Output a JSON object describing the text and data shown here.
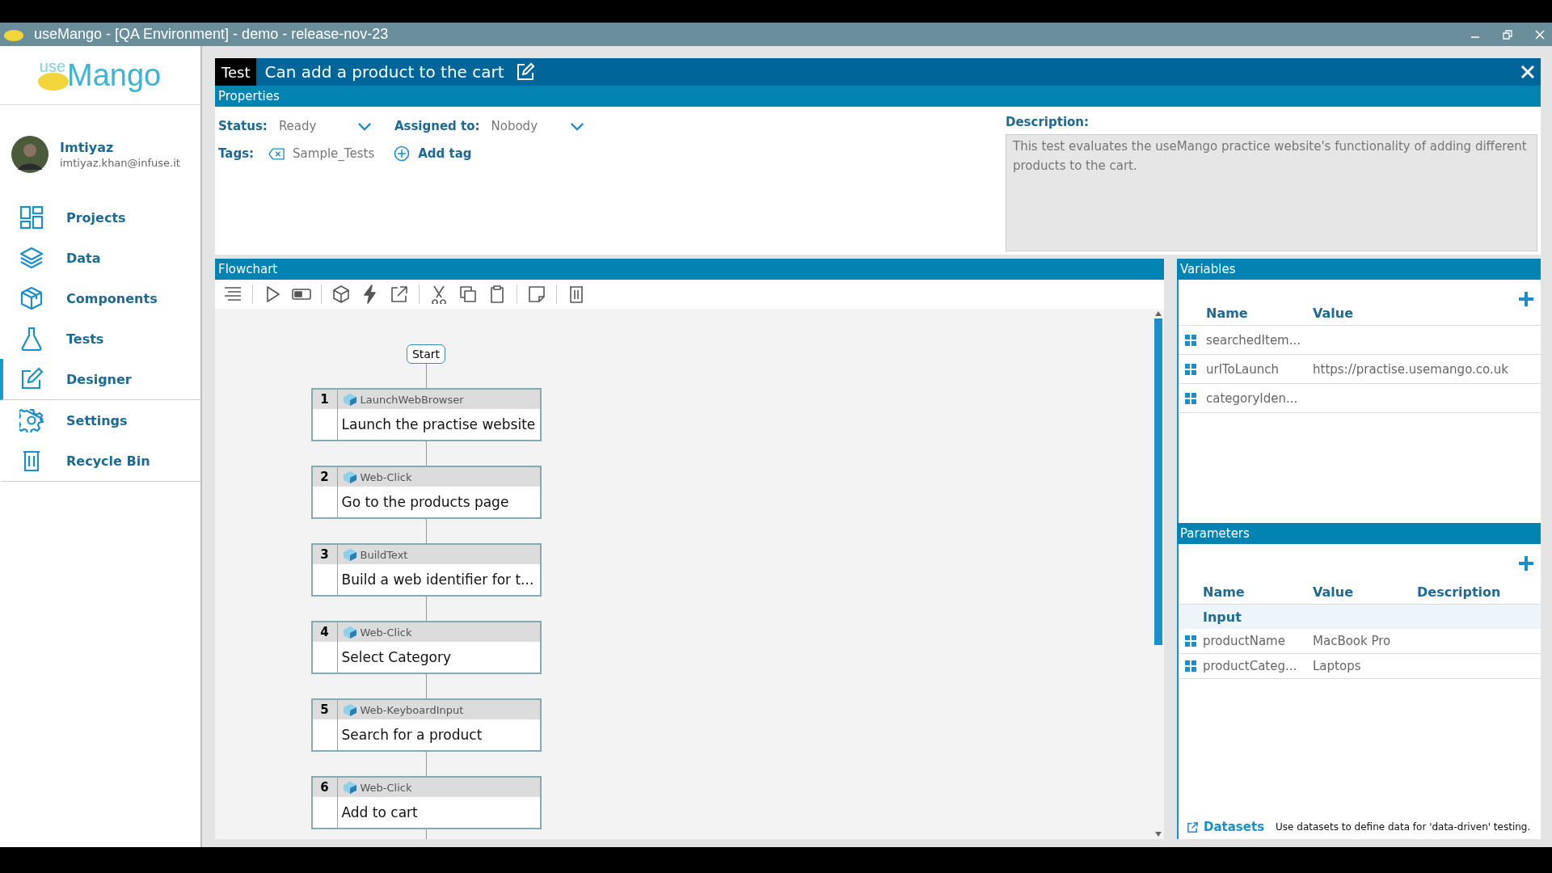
{
  "window": {
    "title": "useMango - [QA Environment] - demo - release-nov-23"
  },
  "logo": {
    "prefix": "use",
    "name": "Mango"
  },
  "user": {
    "name": "Imtiyaz",
    "email": "imtiyaz.khan@infuse.it"
  },
  "nav": [
    {
      "label": "Projects",
      "selected": false
    },
    {
      "label": "Data",
      "selected": false
    },
    {
      "label": "Components",
      "selected": false
    },
    {
      "label": "Tests",
      "selected": false
    },
    {
      "label": "Designer",
      "selected": true
    },
    {
      "label": "Settings",
      "selected": false
    },
    {
      "label": "Recycle Bin",
      "selected": false
    }
  ],
  "test": {
    "badge": "Test",
    "title": "Can add a product to the cart"
  },
  "properties": {
    "header": "Properties",
    "status_label": "Status:",
    "status": "Ready",
    "assigned_label": "Assigned to:",
    "assigned": "Nobody",
    "tags_label": "Tags:",
    "tags": [
      "Sample_Tests"
    ],
    "add_tag": "Add tag",
    "description_label": "Description:",
    "description": "This test evaluates the useMango practice website's functionality of adding different products to the cart."
  },
  "flowchart": {
    "header": "Flowchart",
    "start": "Start",
    "steps": [
      {
        "number": "1",
        "component": "LaunchWebBrowser",
        "text": "Launch the practise website"
      },
      {
        "number": "2",
        "component": "Web-Click",
        "text": "Go to the products page"
      },
      {
        "number": "3",
        "component": "BuildText",
        "text": "Build a web identifier for t..."
      },
      {
        "number": "4",
        "component": "Web-Click",
        "text": "Select Category"
      },
      {
        "number": "5",
        "component": "Web-KeyboardInput",
        "text": "Search for a product"
      },
      {
        "number": "6",
        "component": "Web-Click",
        "text": "Add to cart"
      }
    ]
  },
  "variables": {
    "header": "Variables",
    "columns": [
      "Name",
      "Value"
    ],
    "rows": [
      {
        "name": "searchedItem..."
      },
      {
        "name": "urlToLaunch",
        "value": "https://practise.usemango.co.uk"
      },
      {
        "name": "categoryIden..."
      }
    ]
  },
  "parameters": {
    "header": "Parameters",
    "columns": [
      "Name",
      "Value",
      "Description"
    ],
    "group": "Input",
    "rows": [
      {
        "name": "productName",
        "value": "MacBook Pro"
      },
      {
        "name": "productCateg...",
        "value": "Laptops"
      }
    ]
  },
  "datasets": {
    "link": "Datasets",
    "hint": "Use datasets to define data for 'data-driven' testing."
  }
}
